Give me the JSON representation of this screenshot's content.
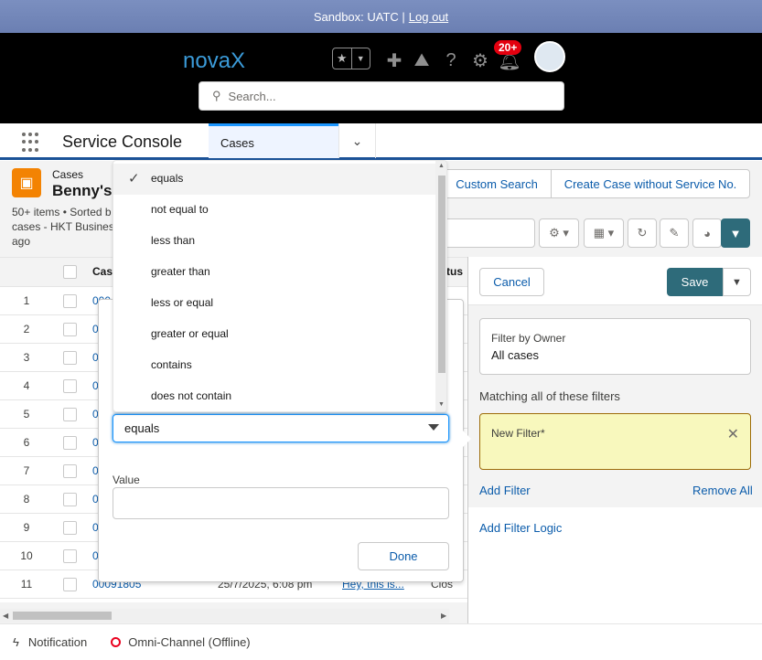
{
  "sandbox": {
    "text": "Sandbox: UATC |",
    "logout": "Log out"
  },
  "header": {
    "logo": "novaX",
    "notification_count": "20+",
    "search_placeholder": "Search..."
  },
  "appnav": {
    "app_name": "Service Console",
    "tab_label": "Cases"
  },
  "list": {
    "object_label": "Cases",
    "title": "Benny's",
    "meta": "50+ items • Sorted b cases - HKT Business ago",
    "buttons": [
      "Custom Search",
      "Create Case without Service No."
    ],
    "col_case": "Case",
    "col_status": "tus",
    "rows": [
      {
        "n": "1",
        "case": "000"
      },
      {
        "n": "2",
        "case": "0"
      },
      {
        "n": "3",
        "case": "0"
      },
      {
        "n": "4",
        "case": "0"
      },
      {
        "n": "5",
        "case": "0"
      },
      {
        "n": "6",
        "case": "0"
      },
      {
        "n": "7",
        "case": "0"
      },
      {
        "n": "8",
        "case": "0"
      },
      {
        "n": "9",
        "case": "0"
      },
      {
        "n": "10",
        "case": "0"
      },
      {
        "n": "11",
        "case": "00091805",
        "date": "25/7/2025, 6:08 pm",
        "subject": "Hey, this is...",
        "status": "Clos"
      }
    ]
  },
  "filter_panel": {
    "cancel": "Cancel",
    "save": "Save",
    "owner_label": "Filter by Owner",
    "owner_value": "All cases",
    "matching_label": "Matching all of these filters",
    "new_filter": "New Filter*",
    "add_filter": "Add Filter",
    "remove_all": "Remove All",
    "add_logic": "Add Filter Logic"
  },
  "popover": {
    "operator_value": "equals",
    "value_label": "Value",
    "value_input": "",
    "done": "Done",
    "options": [
      "equals",
      "not equal to",
      "less than",
      "greater than",
      "less or equal",
      "greater or equal",
      "contains",
      "does not contain"
    ],
    "selected_index": 0
  },
  "utility": {
    "notification": "Notification",
    "omni": "Omni-Channel (Offline)"
  }
}
